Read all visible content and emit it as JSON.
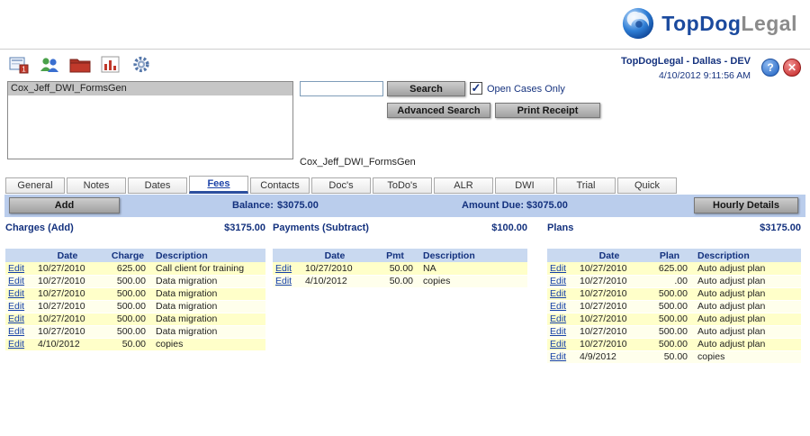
{
  "header": {
    "logo_top": "TopDog",
    "logo_legal": "Legal",
    "app_info": "TopDogLegal - Dallas - DEV",
    "datetime": "4/10/2012 9:11:56 AM",
    "help_glyph": "?",
    "close_glyph": "✕"
  },
  "toolbar": {
    "icons": [
      "case-card-icon",
      "contacts-icon",
      "folder-icon",
      "chart-icon",
      "gear-icon"
    ]
  },
  "case_list": {
    "items": [
      "Cox_Jeff_DWI_FormsGen"
    ]
  },
  "search": {
    "input_value": "",
    "search_button": "Search",
    "open_cases_label": "Open Cases Only",
    "checkbox_glyph": "✓",
    "advanced_button": "Advanced Search",
    "print_button": "Print Receipt"
  },
  "selected_case": "Cox_Jeff_DWI_FormsGen",
  "tabs": [
    "General",
    "Notes",
    "Dates",
    "Fees",
    "Contacts",
    "Doc's",
    "ToDo's",
    "ALR",
    "DWI",
    "Trial",
    "Quick"
  ],
  "active_tab": "Fees",
  "summary_bar": {
    "add_button": "Add",
    "balance_label": "Balance:",
    "balance_value": "$3075.00",
    "amount_due_label": "Amount Due:",
    "amount_due_value": "$3075.00",
    "hourly_button": "Hourly Details"
  },
  "sections": {
    "charges": {
      "title": "Charges (Add)",
      "total": "$3175.00",
      "edit_label": "Edit",
      "headers": [
        "Date",
        "Charge",
        "Description"
      ],
      "rows": [
        [
          "10/27/2010",
          "625.00",
          "Call client for training"
        ],
        [
          "10/27/2010",
          "500.00",
          "Data migration"
        ],
        [
          "10/27/2010",
          "500.00",
          "Data migration"
        ],
        [
          "10/27/2010",
          "500.00",
          "Data migration"
        ],
        [
          "10/27/2010",
          "500.00",
          "Data migration"
        ],
        [
          "10/27/2010",
          "500.00",
          "Data migration"
        ],
        [
          "4/10/2012",
          "50.00",
          "copies"
        ]
      ]
    },
    "payments": {
      "title": "Payments (Subtract)",
      "total": "$100.00",
      "edit_label": "Edit",
      "headers": [
        "Date",
        "Pmt",
        "Description"
      ],
      "rows": [
        [
          "10/27/2010",
          "50.00",
          "NA"
        ],
        [
          "4/10/2012",
          "50.00",
          "copies"
        ]
      ]
    },
    "plans": {
      "title": "Plans",
      "total": "$3175.00",
      "edit_label": "Edit",
      "headers": [
        "Date",
        "Plan",
        "Description"
      ],
      "rows": [
        [
          "10/27/2010",
          "625.00",
          "Auto adjust plan"
        ],
        [
          "10/27/2010",
          ".00",
          "Auto adjust plan"
        ],
        [
          "10/27/2010",
          "500.00",
          "Auto adjust plan"
        ],
        [
          "10/27/2010",
          "500.00",
          "Auto adjust plan"
        ],
        [
          "10/27/2010",
          "500.00",
          "Auto adjust plan"
        ],
        [
          "10/27/2010",
          "500.00",
          "Auto adjust plan"
        ],
        [
          "10/27/2010",
          "500.00",
          "Auto adjust plan"
        ],
        [
          "4/9/2012",
          "50.00",
          "copies"
        ]
      ]
    }
  }
}
